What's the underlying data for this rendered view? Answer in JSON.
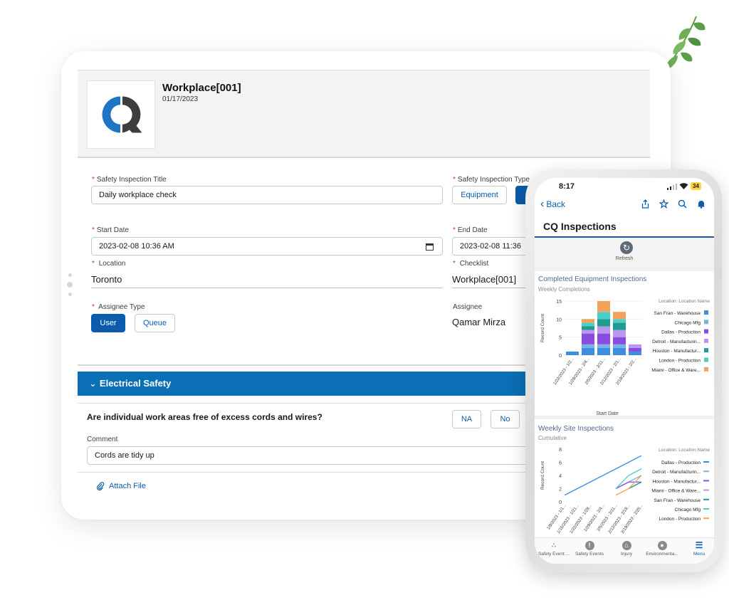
{
  "record": {
    "title": "Workplace[001]",
    "date": "01/17/2023",
    "logo_text": "CQ"
  },
  "form": {
    "inspection_title_label": "Safety Inspection Title",
    "inspection_title_value": "Daily workplace check",
    "inspection_type_label": "Safety Inspection Type",
    "inspection_type_option": "Equipment",
    "start_date_label": "Start Date",
    "start_date_value": "2023-02-08  10:36  AM",
    "end_date_label": "End Date",
    "end_date_value": "2023-02-08  11:36",
    "location_label": "Location",
    "location_value": "Toronto",
    "checklist_label": "Checklist",
    "checklist_value": "Workplace[001]",
    "assignee_type_label": "Assignee Type",
    "assignee_type_user": "User",
    "assignee_type_queue": "Queue",
    "assignee_label": "Assignee",
    "assignee_value": "Qamar Mirza"
  },
  "section": {
    "title": "Electrical Safety",
    "question": "Are individual work areas free of excess cords and wires?",
    "answer_na": "NA",
    "answer_no": "No",
    "comment_label": "Comment",
    "comment_value": "Cords are tidy up",
    "attach_label": "Attach File"
  },
  "phone": {
    "time": "8:17",
    "battery": "34",
    "back_label": "Back",
    "title": "CQ Inspections",
    "refresh_label": "Refresh",
    "tabs": [
      "Safety Event ...",
      "Safety Events",
      "Injury",
      "Environmenta...",
      "Menu"
    ]
  },
  "colors": {
    "brand_blue": "#0b5cab",
    "section_blue": "#0b6fb5",
    "required_red": "#c23934"
  },
  "chart_data": [
    {
      "type": "bar",
      "stacked": true,
      "title": "Completed Equipment Inspections",
      "subtitle": "Weekly Completions",
      "ylabel": "Record Count",
      "xlabel": "Start Date",
      "ylim": [
        0,
        15
      ],
      "yticks": [
        0,
        5,
        10,
        15
      ],
      "legend_title": "Location: Location Name",
      "legend_position": "right",
      "categories": [
        "1/22/2023 - 1/2...",
        "1/29/2023 - 2/4...",
        "2/5/2023 - 2/11...",
        "2/12/2023 - 2/1...",
        "2/19/2023 - 2/2..."
      ],
      "series": [
        {
          "name": "San Fran - Warehouse",
          "color": "#3a8fde",
          "values": [
            1,
            2,
            2,
            2,
            1
          ]
        },
        {
          "name": "Chicago Mfg",
          "color": "#78b0e8",
          "values": [
            0,
            1,
            1,
            1,
            0
          ]
        },
        {
          "name": "Dallas - Production",
          "color": "#8a4be0",
          "values": [
            0,
            3,
            3,
            2,
            1
          ]
        },
        {
          "name": "Detroit - Manufacturin...",
          "color": "#b996f0",
          "values": [
            0,
            1,
            2,
            2,
            1
          ]
        },
        {
          "name": "Houston - Manufactur...",
          "color": "#1f9c8f",
          "values": [
            0,
            1,
            2,
            2,
            0
          ]
        },
        {
          "name": "London - Production",
          "color": "#4ccfc7",
          "values": [
            0,
            1,
            2,
            1,
            0
          ]
        },
        {
          "name": "Miami - Office & Ware...",
          "color": "#f2a25a",
          "values": [
            0,
            1,
            3,
            2,
            0
          ]
        }
      ]
    },
    {
      "type": "line",
      "title": "Weekly Site Inspections",
      "subtitle": "Cumulative",
      "ylabel": "Record Count",
      "ylim": [
        0,
        8
      ],
      "yticks": [
        0,
        2,
        4,
        6,
        8
      ],
      "legend_title": "Location: Location Name",
      "legend_position": "right",
      "categories": [
        "1/8/2023 - 1/1...",
        "1/15/2023 - 1/21...",
        "1/22/2023 - 1/28...",
        "1/29/2023 - 2/4...",
        "2/5/2023 - 2/11...",
        "2/12/2023 - 2/18...",
        "2/19/2023 - 2/25..."
      ],
      "series": [
        {
          "name": "Dallas - Production",
          "color": "#3a8fde",
          "values": [
            1,
            2,
            3,
            4,
            5,
            6,
            7
          ]
        },
        {
          "name": "Detroit - Manufacturin...",
          "color": "#78b0e8",
          "values": [
            null,
            null,
            null,
            null,
            2,
            3,
            4
          ]
        },
        {
          "name": "Houston - Manufactur...",
          "color": "#8a4be0",
          "values": [
            null,
            null,
            null,
            null,
            2,
            3,
            3
          ]
        },
        {
          "name": "Miami - Office & Ware...",
          "color": "#b996f0",
          "values": [
            null,
            null,
            null,
            null,
            null,
            2,
            3
          ]
        },
        {
          "name": "San Fran - Warehouse",
          "color": "#1f9c8f",
          "values": [
            null,
            null,
            null,
            null,
            null,
            2,
            3
          ]
        },
        {
          "name": "Chicago Mfg",
          "color": "#4ccfc7",
          "values": [
            null,
            null,
            null,
            null,
            2,
            4,
            5
          ]
        },
        {
          "name": "London - Production",
          "color": "#f2a25a",
          "values": [
            null,
            null,
            null,
            null,
            1,
            2,
            4
          ]
        }
      ]
    }
  ]
}
